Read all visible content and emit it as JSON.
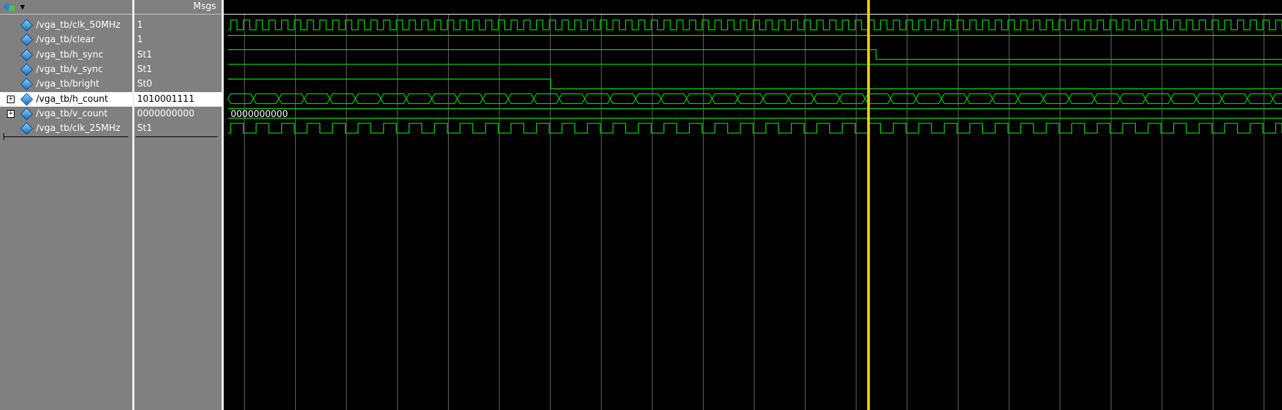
{
  "header": {
    "values_title": "Msgs",
    "icon": "wave-window-icon",
    "dropdown_icon": "dropdown-arrow-icon"
  },
  "signals": [
    {
      "name": "/vga_tb/clk_50MHz",
      "value": "1",
      "expandable": false,
      "selected": false,
      "icon": "signal-diamond-icon"
    },
    {
      "name": "/vga_tb/clear",
      "value": "1",
      "expandable": false,
      "selected": false,
      "icon": "signal-diamond-icon"
    },
    {
      "name": "/vga_tb/h_sync",
      "value": "St1",
      "expandable": false,
      "selected": false,
      "icon": "signal-diamond-icon"
    },
    {
      "name": "/vga_tb/v_sync",
      "value": "St1",
      "expandable": false,
      "selected": false,
      "icon": "signal-diamond-icon"
    },
    {
      "name": "/vga_tb/bright",
      "value": "St0",
      "expandable": false,
      "selected": false,
      "icon": "signal-diamond-icon"
    },
    {
      "name": "/vga_tb/h_count",
      "value": "1010001111",
      "expandable": true,
      "selected": true,
      "icon": "signal-diamond-icon"
    },
    {
      "name": "/vga_tb/v_count",
      "value": "0000000000",
      "expandable": true,
      "selected": false,
      "icon": "signal-diamond-icon"
    },
    {
      "name": "/vga_tb/clk_25MHz",
      "value": "St1",
      "expandable": false,
      "selected": false,
      "icon": "signal-diamond-icon"
    }
  ],
  "waveform": {
    "bus_label_v_count": "0000000000",
    "colors": {
      "signal": "#00d400",
      "grid": "#6a6a6a",
      "cursor": "#f0c800",
      "background": "#000000"
    }
  }
}
